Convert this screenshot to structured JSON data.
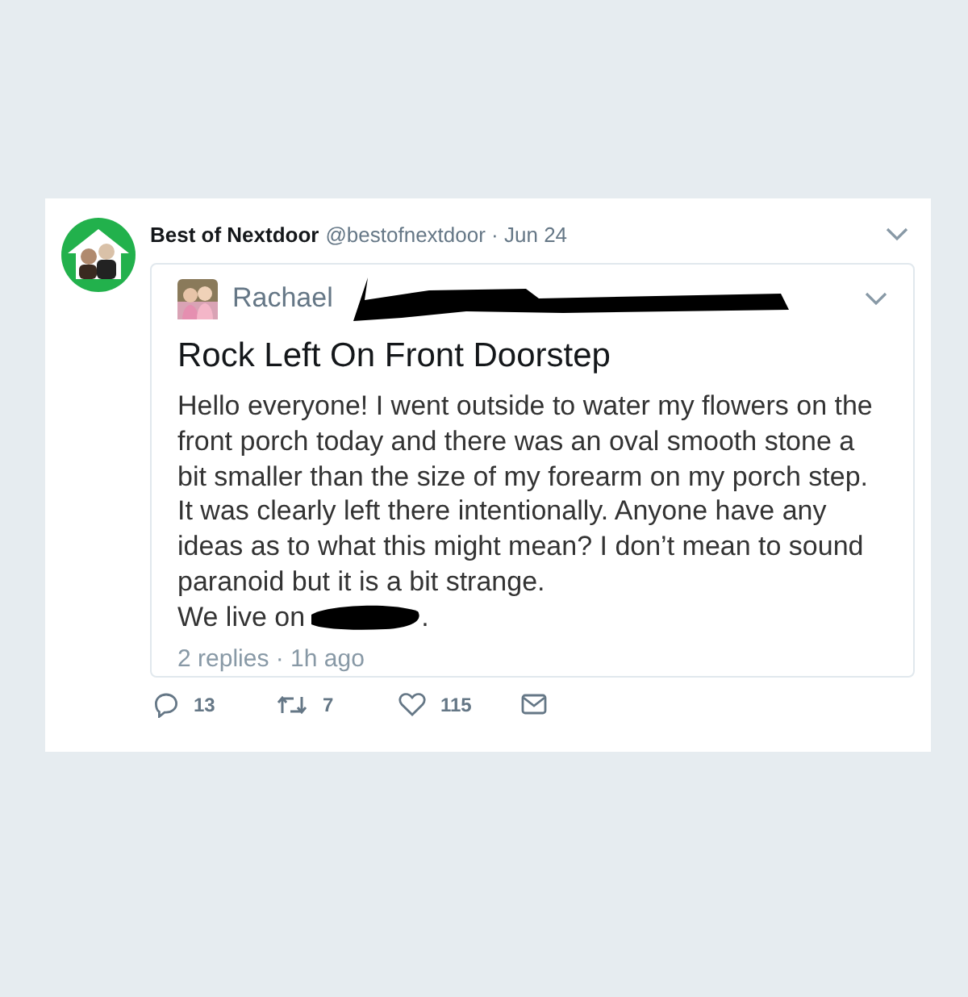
{
  "tweet": {
    "name": "Best of Nextdoor",
    "handle": "@bestofnextdoor",
    "separator": "·",
    "date": "Jun 24",
    "quoted": {
      "author": "Rachael",
      "title": "Rock Left On Front Doorstep",
      "body": "Hello everyone! I went outside to water my flowers on the front porch today and there was an oval smooth stone a bit smaller than the size of my forearm on my porch step. It was clearly left there intentionally. Anyone have any ideas as to what this might mean? I don’t mean to sound paranoid but it is a bit strange.",
      "body_tail": "We live on",
      "body_end": ".",
      "meta": "2 replies · 1h ago"
    },
    "actions": [
      {
        "kind": "reply",
        "count": "13"
      },
      {
        "kind": "retweet",
        "count": "7"
      },
      {
        "kind": "like",
        "count": "115"
      },
      {
        "kind": "message"
      }
    ]
  }
}
